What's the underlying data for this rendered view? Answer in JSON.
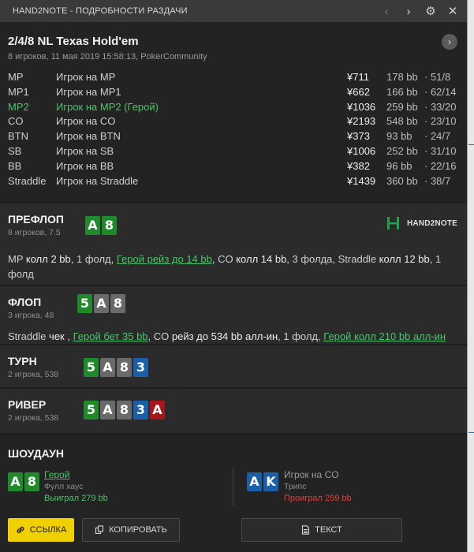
{
  "window": {
    "title": "HAND2NOTE - ПОДРОБНОСТИ РАЗДАЧИ"
  },
  "header": {
    "title": "2/4/8 NL Texas Hold'em",
    "subtitle": "8 игроков, 11 мая 2019 15:58:13, PokerCommunity"
  },
  "players": [
    {
      "pos": "MP",
      "name": "Игрок на MP",
      "chips": "¥711",
      "bb": "178 bb",
      "ratio": "· 51/8"
    },
    {
      "pos": "MP1",
      "name": "Игрок на MP1",
      "chips": "¥662",
      "bb": "166 bb",
      "ratio": "· 62/14"
    },
    {
      "pos": "MP2",
      "name": "Игрок на MP2 (Герой)",
      "chips": "¥1036",
      "bb": "259 bb",
      "ratio": "· 33/20"
    },
    {
      "pos": "CO",
      "name": "Игрок на CO",
      "chips": "¥2193",
      "bb": "548 bb",
      "ratio": "· 23/10"
    },
    {
      "pos": "BTN",
      "name": "Игрок на BTN",
      "chips": "¥373",
      "bb": "93 bb",
      "ratio": "· 24/7"
    },
    {
      "pos": "SB",
      "name": "Игрок на SB",
      "chips": "¥1006",
      "bb": "252 bb",
      "ratio": "· 31/10"
    },
    {
      "pos": "BB",
      "name": "Игрок на BB",
      "chips": "¥382",
      "bb": "96 bb",
      "ratio": "· 22/16"
    },
    {
      "pos": "Straddle",
      "name": "Игрок на Straddle",
      "chips": "¥1439",
      "bb": "360 bb",
      "ratio": "· 38/7"
    }
  ],
  "brand": {
    "word": "HAND2NOTE"
  },
  "preflop": {
    "label": "ПРЕФЛОП",
    "meta": "8 игроков, 7.5",
    "cards": [
      "A",
      "8"
    ],
    "a": [
      "MP",
      " колл 2 bb",
      ", 1 фолд, ",
      "Герой рейз до 14 bb",
      ", CO ",
      "колл 14 bb",
      ", 3 фолда, Straddle ",
      "колл 12 bb",
      ", 1 фолд"
    ]
  },
  "flop": {
    "label": "ФЛОП",
    "meta": "3 игрока, 48",
    "cards": [
      "5",
      "A",
      "8"
    ],
    "a": [
      "Straddle ",
      "чек ",
      ", ",
      "Герой бет 35 bb",
      ", CO ",
      "рейз до 534 bb алл-ин",
      ", 1 фолд, ",
      "Герой колл 210 bb алл-ин"
    ]
  },
  "turn": {
    "label": "ТУРН",
    "meta": "2 игрока, 538",
    "cards": [
      "5",
      "A",
      "8",
      "3"
    ]
  },
  "river": {
    "label": "РИВЕР",
    "meta": "2 игрока, 538",
    "cards": [
      "5",
      "A",
      "8",
      "3",
      "A"
    ]
  },
  "showdown": {
    "label": "ШОУДАУН",
    "hero": {
      "cards": [
        "A",
        "8"
      ],
      "name": "Герой",
      "hand": "Фулл хаус",
      "result": "Выиграл 279 bb"
    },
    "villain": {
      "cards": [
        "A",
        "K"
      ],
      "name": "Игрок на CO",
      "hand": "Трипс",
      "result": "Проиграл 259 bb"
    }
  },
  "buttons": {
    "link": "ССЫЛКА",
    "copy": "КОПИРОВАТЬ",
    "text": "ТЕКСТ"
  },
  "icons": [
    "chevron-left-icon",
    "chevron-right-icon",
    "gear-icon",
    "close-icon",
    "chevron-right-circle-icon",
    "link-icon",
    "copy-icon",
    "document-icon"
  ],
  "colors": {
    "hero": "#4cc46b",
    "win": "#4cc46b",
    "lose": "#e23b3b",
    "link_button": "#f0d000"
  }
}
